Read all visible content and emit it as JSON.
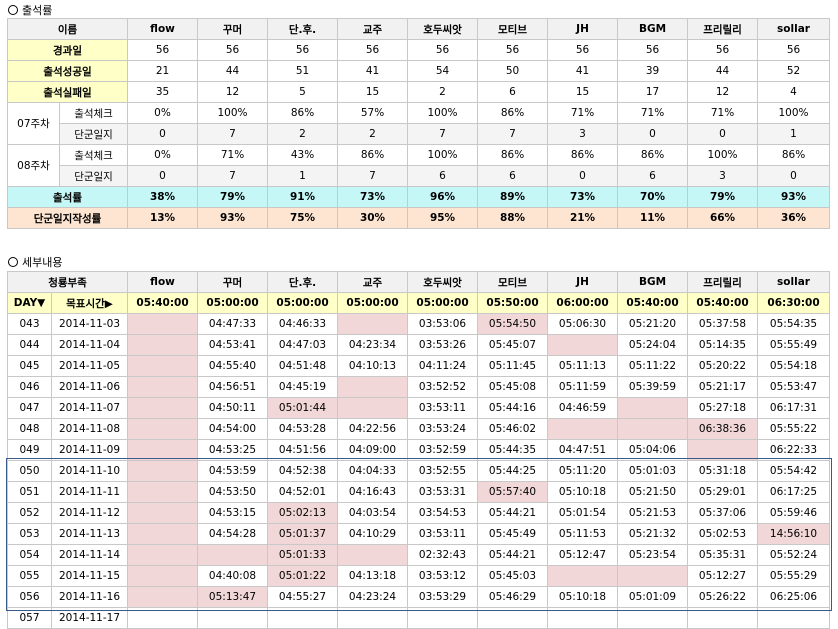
{
  "attendance": {
    "section_title": "출석률",
    "header": [
      "이름",
      "flow",
      "꾸머",
      "단.후.",
      "교주",
      "호두씨앗",
      "모티브",
      "JH",
      "BGM",
      "프리릴리",
      "sollar"
    ],
    "elapsed": {
      "label": "경과일",
      "values": [
        "56",
        "56",
        "56",
        "56",
        "56",
        "56",
        "56",
        "56",
        "56",
        "56"
      ]
    },
    "success": {
      "label": "출석성공일",
      "values": [
        "21",
        "44",
        "51",
        "41",
        "54",
        "50",
        "41",
        "39",
        "44",
        "52"
      ]
    },
    "fail": {
      "label": "출석실패일",
      "values": [
        "35",
        "12",
        "5",
        "15",
        "2",
        "6",
        "15",
        "17",
        "12",
        "4"
      ]
    },
    "week07": {
      "label": "07주차",
      "check_label": "출석체크",
      "check": [
        "0%",
        "100%",
        "86%",
        "57%",
        "100%",
        "86%",
        "71%",
        "71%",
        "71%",
        "100%"
      ],
      "diary_label": "단군일지",
      "diary": [
        "0",
        "7",
        "2",
        "2",
        "7",
        "7",
        "3",
        "0",
        "0",
        "1"
      ]
    },
    "week08": {
      "label": "08주차",
      "check_label": "출석체크",
      "check": [
        "0%",
        "71%",
        "43%",
        "86%",
        "100%",
        "86%",
        "86%",
        "86%",
        "100%",
        "86%"
      ],
      "diary_label": "단군일지",
      "diary": [
        "0",
        "7",
        "1",
        "7",
        "6",
        "6",
        "0",
        "6",
        "3",
        "0"
      ]
    },
    "rate": {
      "label": "출석률",
      "values": [
        "38%",
        "79%",
        "91%",
        "73%",
        "96%",
        "89%",
        "73%",
        "70%",
        "79%",
        "93%"
      ]
    },
    "diary_rate": {
      "label": "단군일지작성률",
      "values": [
        "13%",
        "93%",
        "75%",
        "30%",
        "95%",
        "88%",
        "21%",
        "11%",
        "66%",
        "36%"
      ]
    }
  },
  "detail": {
    "section_title": "세부내용",
    "header": [
      "청룡부족",
      "flow",
      "꾸머",
      "단.후.",
      "교주",
      "호두씨앗",
      "모티브",
      "JH",
      "BGM",
      "프리릴리",
      "sollar"
    ],
    "day_label": "DAY▼",
    "target_label": "목표시간▶",
    "targets": [
      "05:40:00",
      "05:00:00",
      "05:00:00",
      "05:00:00",
      "05:00:00",
      "05:50:00",
      "06:00:00",
      "05:40:00",
      "05:40:00",
      "06:30:00"
    ],
    "rows": [
      {
        "day": "043",
        "date": "2014-11-03",
        "cells": [
          "",
          "04:47:33",
          "04:46:33",
          "",
          "03:53:06",
          "05:54:50",
          "05:06:30",
          "05:21:20",
          "05:37:58",
          "05:54:35"
        ],
        "pink": [
          0,
          3,
          5
        ]
      },
      {
        "day": "044",
        "date": "2014-11-04",
        "cells": [
          "",
          "04:53:41",
          "04:47:03",
          "04:23:34",
          "03:53:26",
          "05:45:07",
          "",
          "05:24:04",
          "05:14:35",
          "05:55:49"
        ],
        "pink": [
          0,
          6
        ]
      },
      {
        "day": "045",
        "date": "2014-11-05",
        "cells": [
          "",
          "04:55:40",
          "04:51:48",
          "04:10:13",
          "04:11:24",
          "05:11:45",
          "05:11:13",
          "05:11:22",
          "05:20:22",
          "05:54:18"
        ],
        "pink": [
          0
        ]
      },
      {
        "day": "046",
        "date": "2014-11-06",
        "cells": [
          "",
          "04:56:51",
          "04:45:19",
          "",
          "03:52:52",
          "05:45:08",
          "05:11:59",
          "05:39:59",
          "05:21:17",
          "05:53:47"
        ],
        "pink": [
          0,
          3
        ]
      },
      {
        "day": "047",
        "date": "2014-11-07",
        "cells": [
          "",
          "04:50:11",
          "05:01:44",
          "",
          "03:53:11",
          "05:44:16",
          "04:46:59",
          "",
          "05:27:18",
          "06:17:31"
        ],
        "pink": [
          0,
          2,
          3,
          7
        ]
      },
      {
        "day": "048",
        "date": "2014-11-08",
        "cells": [
          "",
          "04:54:00",
          "04:53:28",
          "04:22:56",
          "03:53:24",
          "05:46:02",
          "",
          "",
          "06:38:36",
          "05:55:22"
        ],
        "pink": [
          0,
          6,
          7,
          8
        ]
      },
      {
        "day": "049",
        "date": "2014-11-09",
        "cells": [
          "",
          "04:53:25",
          "04:51:56",
          "04:09:00",
          "03:52:59",
          "05:44:35",
          "04:47:51",
          "05:04:06",
          "",
          "06:22:33"
        ],
        "pink": [
          0,
          8
        ]
      },
      {
        "day": "050",
        "date": "2014-11-10",
        "cells": [
          "",
          "04:53:59",
          "04:52:38",
          "04:04:33",
          "03:52:55",
          "05:44:25",
          "05:11:20",
          "05:01:03",
          "05:31:18",
          "05:54:42"
        ],
        "pink": [
          0
        ]
      },
      {
        "day": "051",
        "date": "2014-11-11",
        "cells": [
          "",
          "04:53:50",
          "04:52:01",
          "04:16:43",
          "03:53:31",
          "05:57:40",
          "05:10:18",
          "05:21:50",
          "05:29:01",
          "06:17:25"
        ],
        "pink": [
          0,
          5
        ]
      },
      {
        "day": "052",
        "date": "2014-11-12",
        "cells": [
          "",
          "04:53:15",
          "05:02:13",
          "04:03:54",
          "03:54:53",
          "05:44:21",
          "05:01:54",
          "05:21:53",
          "05:37:06",
          "05:59:46"
        ],
        "pink": [
          0,
          2
        ]
      },
      {
        "day": "053",
        "date": "2014-11-13",
        "cells": [
          "",
          "04:54:28",
          "05:01:37",
          "04:10:29",
          "03:53:11",
          "05:45:49",
          "05:11:53",
          "05:21:32",
          "05:02:53",
          "14:56:10"
        ],
        "pink": [
          0,
          2,
          9
        ]
      },
      {
        "day": "054",
        "date": "2014-11-14",
        "cells": [
          "",
          "",
          "05:01:33",
          "",
          "02:32:43",
          "05:44:21",
          "05:12:47",
          "05:23:54",
          "05:35:31",
          "05:52:24"
        ],
        "pink": [
          0,
          1,
          2,
          3
        ]
      },
      {
        "day": "055",
        "date": "2014-11-15",
        "cells": [
          "",
          "04:40:08",
          "05:01:22",
          "04:13:18",
          "03:53:12",
          "05:45:03",
          "",
          "",
          "05:12:27",
          "05:55:29"
        ],
        "pink": [
          0,
          2,
          6,
          7
        ]
      },
      {
        "day": "056",
        "date": "2014-11-16",
        "cells": [
          "",
          "05:13:47",
          "04:55:27",
          "04:23:24",
          "03:53:29",
          "05:46:29",
          "05:10:18",
          "05:01:09",
          "05:26:22",
          "06:25:06"
        ],
        "pink": [
          0,
          1
        ]
      },
      {
        "day": "057",
        "date": "2014-11-17",
        "cells": [
          "",
          "",
          "",
          "",
          "",
          "",
          "",
          "",
          "",
          ""
        ],
        "pink": []
      }
    ]
  }
}
